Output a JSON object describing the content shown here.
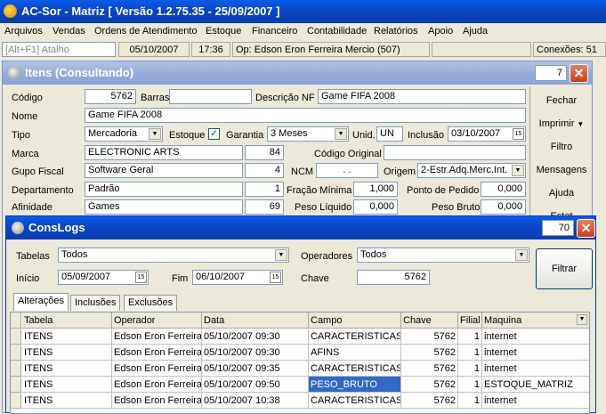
{
  "app_title": "AC-Sor - Matriz  [ Versão 1.2.75.35 - 25/09/2007 ]",
  "menu": [
    "Arquivos",
    "Vendas",
    "Ordens de Atendimento",
    "Estoque",
    "Financeiro",
    "Contabilidade",
    "Relatórios",
    "Apoio",
    "Ajuda"
  ],
  "status": {
    "shortcut": "[Alt+F1] Atalho",
    "date": "05/10/2007",
    "time": "17:36",
    "operator": "Op: Edson Eron Ferreira Mercio (507)",
    "connections": "Conexões: 51"
  },
  "itens": {
    "title": "Itens (Consultando)",
    "counter": "7",
    "codigo_label": "Código",
    "codigo": "5762",
    "barras_label": "Barras",
    "barras": "",
    "descricao_label": "Descrição NF",
    "descricao": "Game FIFA 2008",
    "nome_label": "Nome",
    "nome": "Game FIFA 2008",
    "tipo_label": "Tipo",
    "tipo": "Mercadoria",
    "estoque_label": "Estoque",
    "garantia_label": "Garantia",
    "garantia": "3 Meses",
    "unid_label": "Unid.",
    "unid": "UN",
    "inclusao_label": "Inclusão",
    "inclusao": "03/10/2007",
    "marca_label": "Marca",
    "marca": "ELECTRONIC ARTS",
    "marca_cod": "84",
    "codigo_original_label": "Código Original",
    "codigo_original": "",
    "grupo_label": "Gupo Fiscal",
    "grupo": "Software Geral",
    "grupo_cod": "4",
    "ncm_label": "NCM",
    "ncm": ". .",
    "origem_label": "Origem",
    "origem": "2-Estr.Adq.Merc.Int.",
    "depto_label": "Departamento",
    "depto": "Padrão",
    "depto_cod": "1",
    "fracao_label": "Fração Mínima",
    "fracao": "1,000",
    "pedido_label": "Ponto de Pedido",
    "pedido": "0,000",
    "afinidade_label": "Afinidade",
    "afinidade": "Games",
    "afinidade_cod": "69",
    "peso_liq_label": "Peso Líquido",
    "peso_liq": "0,000",
    "peso_bruto_label": "Peso Bruto",
    "peso_bruto": "0,000",
    "side": [
      "Fechar",
      "Imprimir",
      "Filtro",
      "Mensagens",
      "Ajuda",
      "Estat"
    ]
  },
  "conslogs": {
    "title": "ConsLogs",
    "counter": "70",
    "tabelas_label": "Tabelas",
    "tabelas": "Todos",
    "operadores_label": "Operadores",
    "operadores": "Todos",
    "inicio_label": "Início",
    "inicio": "05/09/2007",
    "fim_label": "Fim",
    "fim": "06/10/2007",
    "chave_label": "Chave",
    "chave": "5762",
    "filtrar": "Filtrar",
    "tabs": [
      "Alterações",
      "Inclusões",
      "Exclusões"
    ],
    "columns": [
      "Tabela",
      "Operador",
      "Data",
      "Campo",
      "Chave",
      "Filial",
      "Maquina"
    ],
    "rows": [
      [
        "ITENS",
        "Edson Eron Ferreira Mercio",
        "05/10/2007 09:30",
        "CARACTERISTICAS",
        "5762",
        "1",
        "internet"
      ],
      [
        "ITENS",
        "Edson Eron Ferreira Mercio",
        "05/10/2007 09:30",
        "AFINS",
        "5762",
        "1",
        "internet"
      ],
      [
        "ITENS",
        "Edson Eron Ferreira Mercio",
        "05/10/2007 09:35",
        "CARACTERISTICAS",
        "5762",
        "1",
        "internet"
      ],
      [
        "ITENS",
        "Edson Eron Ferreira Mercio",
        "05/10/2007 09:50",
        "PESO_BRUTO",
        "5762",
        "1",
        "ESTOQUE_MATRIZ"
      ],
      [
        "ITENS",
        "Edson Eron Ferreira Mercio",
        "05/10/2007 10:38",
        "CARACTERISTICAS",
        "5762",
        "1",
        "internet"
      ]
    ]
  }
}
